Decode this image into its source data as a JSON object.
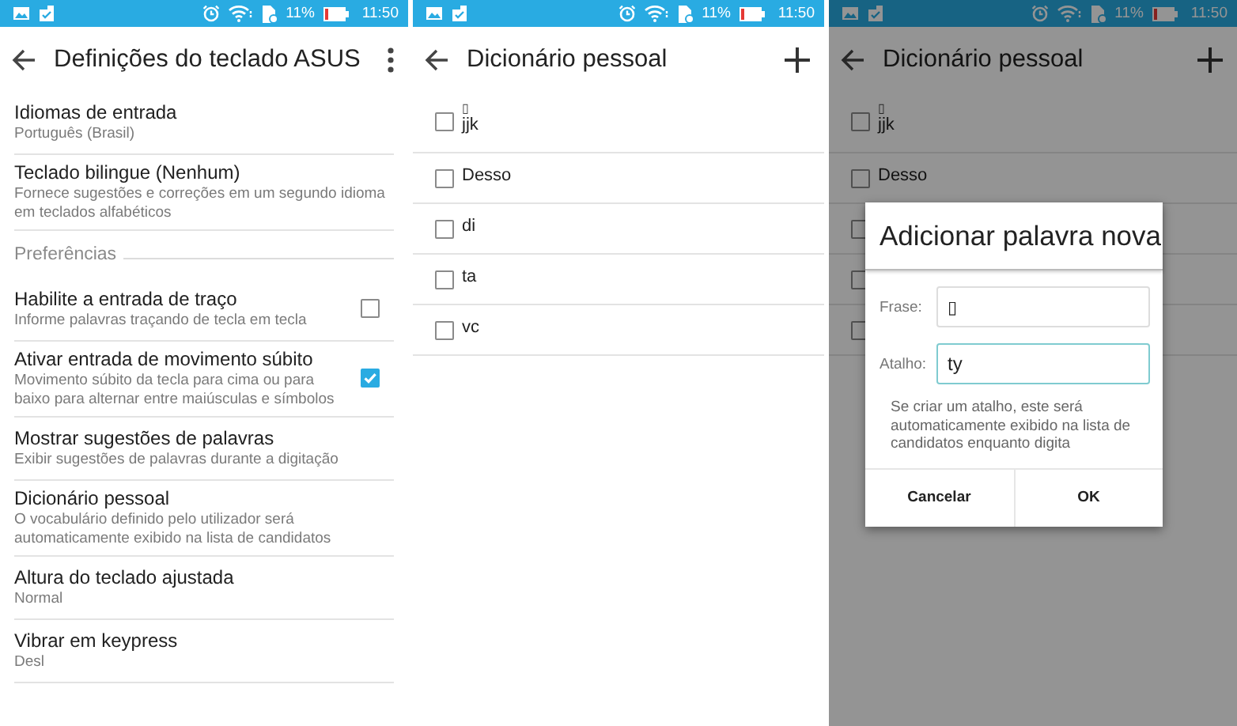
{
  "screens": [
    {
      "kind": "settings",
      "status": {
        "battery": "11%",
        "time": "11:50"
      },
      "app_bar": {
        "title": "Definições do teclado ASUS"
      },
      "items": [
        {
          "kind": "item",
          "title": "Idiomas de entrada",
          "summary": "Português (Brasil)"
        },
        {
          "kind": "item",
          "title": "Teclado bilingue (Nenhum)",
          "summary": "Fornece sugestões e correções em um segundo idioma em teclados alfabéticos"
        },
        {
          "kind": "category",
          "title": "Preferências"
        },
        {
          "kind": "checkbox",
          "title": "Habilite a entrada de traço",
          "summary": "Informe palavras traçando de tecla em tecla",
          "checked": false
        },
        {
          "kind": "checkbox",
          "title": "Ativar entrada de movimento súbito",
          "summary": "Movimento súbito da tecla para cima ou para baixo para alternar entre maiúsculas e símbolos",
          "checked": true
        },
        {
          "kind": "item",
          "title": "Mostrar sugestões de palavras",
          "summary": "Exibir sugestões de palavras durante a digitação"
        },
        {
          "kind": "item",
          "title": "Dicionário pessoal",
          "summary": "O vocabulário definido pelo utilizador será automaticamente exibido na lista de candidatos"
        },
        {
          "kind": "item",
          "title": "Altura do teclado ajustada",
          "summary": "Normal"
        },
        {
          "kind": "item",
          "title": "Vibrar em keypress",
          "summary": "Desl"
        }
      ]
    },
    {
      "kind": "dictionary",
      "status": {
        "battery": "11%",
        "time": "11:50"
      },
      "app_bar": {
        "title": "Dicionário pessoal"
      },
      "words": [
        {
          "phrase": "▯",
          "shortcut": "jjk",
          "checked": false
        },
        {
          "phrase": "Desso",
          "checked": false
        },
        {
          "phrase": "di",
          "checked": false
        },
        {
          "phrase": "ta",
          "checked": false
        },
        {
          "phrase": "vc",
          "checked": false
        }
      ]
    },
    {
      "kind": "dictionary",
      "dimmed": true,
      "status": {
        "battery": "11%",
        "time": "11:50"
      },
      "app_bar": {
        "title": "Dicionário pessoal"
      },
      "words": [
        {
          "phrase": "▯",
          "shortcut": "jjk",
          "checked": false
        },
        {
          "phrase": "Desso",
          "checked": false
        },
        {
          "checked": false
        },
        {
          "checked": false
        },
        {
          "checked": false
        }
      ],
      "dialog": {
        "title": "Adicionar palavra nova",
        "fields": [
          {
            "label": "Frase:",
            "value": "▯",
            "focused": false
          },
          {
            "label": "Atalho:",
            "value": "ty",
            "focused": true
          }
        ],
        "hint": "Se criar um atalho, este será automaticamente exibido na lista de candidatos enquanto digita",
        "buttons": [
          "Cancelar",
          "OK"
        ]
      }
    }
  ]
}
